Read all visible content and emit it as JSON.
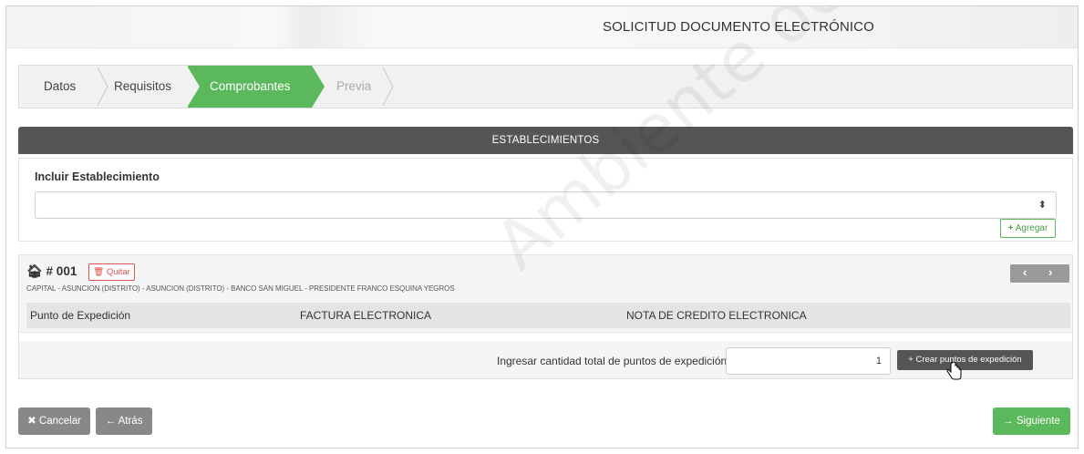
{
  "header": {
    "title": "SOLICITUD DOCUMENTO ELECTRÓNICO"
  },
  "steps": [
    {
      "label": "Datos",
      "state": "done"
    },
    {
      "label": "Requisitos",
      "state": "done"
    },
    {
      "label": "Comprobantes",
      "state": "active"
    },
    {
      "label": "Previa",
      "state": "pending"
    }
  ],
  "establecimientos": {
    "bar_title": "ESTABLECIMIENTOS",
    "incluir_label": "Incluir Establecimiento",
    "select_value": "",
    "agregar_label": "Agregar"
  },
  "estab": {
    "number": "# 001",
    "quitar_label": "Quitar",
    "address": "CAPITAL - ASUNCION (DISTRITO) - ASUNCION (DISTRITO) - BANCO SAN MIGUEL - PRESIDENTE FRANCO ESQUINA YEGROS",
    "columns": [
      "Punto de Expedición",
      "FACTURA ELECTRONICA",
      "NOTA DE CREDITO ELECTRONICA"
    ],
    "ingresar_label": "Ingresar cantidad total de puntos de expedición",
    "quantity": "1",
    "crear_label": "Crear puntos de expedición"
  },
  "footer": {
    "cancel_label": "Cancelar",
    "back_label": "Atrás",
    "next_label": "Siguiente"
  },
  "watermark": "Ambiente de Pruebas",
  "colors": {
    "green": "#5cb85c",
    "dark": "#555555",
    "danger": "#d9534f"
  }
}
